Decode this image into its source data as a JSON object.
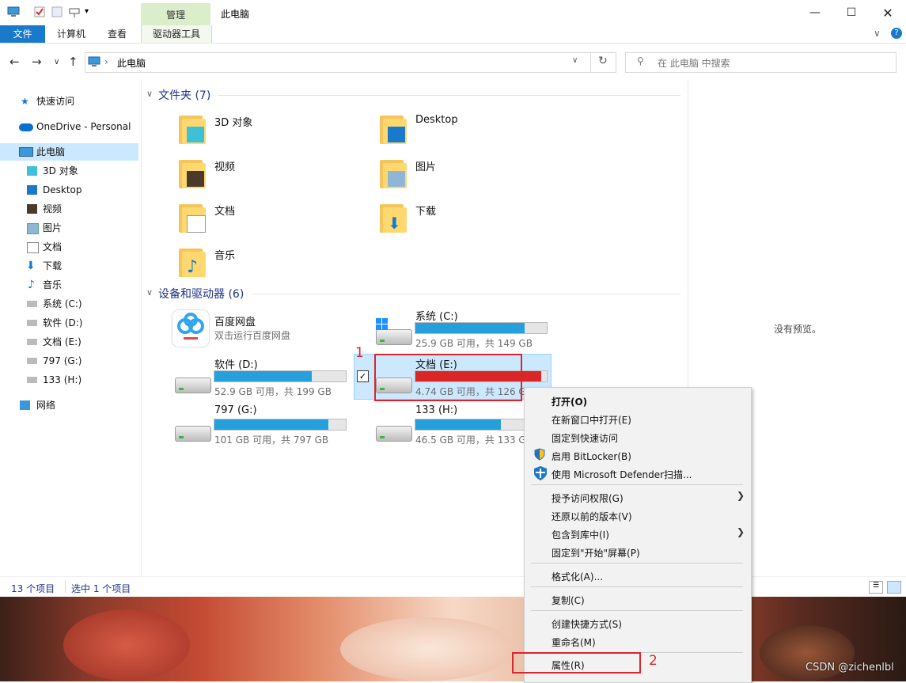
{
  "window": {
    "title": "此电脑",
    "manage_tab": "管理"
  },
  "ribbon": {
    "tabs": [
      "文件",
      "计算机",
      "查看",
      "驱动器工具"
    ]
  },
  "address": {
    "path": "此电脑",
    "search_placeholder": "在 此电脑 中搜索"
  },
  "sidebar": {
    "quick_access": "快速访问",
    "onedrive": "OneDrive - Personal",
    "this_pc": "此电脑",
    "items": [
      "3D 对象",
      "Desktop",
      "视频",
      "图片",
      "文档",
      "下载",
      "音乐",
      "系统 (C:)",
      "软件 (D:)",
      "文档 (E:)",
      "797 (G:)",
      "133 (H:)"
    ],
    "network": "网络"
  },
  "folders_section": {
    "heading": "文件夹 (7)",
    "items": [
      "3D 对象",
      "Desktop",
      "视频",
      "图片",
      "文档",
      "下载",
      "音乐"
    ]
  },
  "devices_section": {
    "heading": "设备和驱动器 (6)",
    "baidu": {
      "name": "百度网盘",
      "sub": "双击运行百度网盘"
    },
    "drives": [
      {
        "name": "系统 (C:)",
        "sub": "25.9 GB 可用，共 149 GB",
        "used_fraction": 0.83
      },
      {
        "name": "软件 (D:)",
        "sub": "52.9 GB 可用，共 199 GB",
        "used_fraction": 0.74
      },
      {
        "name": "文档 (E:)",
        "sub": "4.74 GB 可用，共 126 GB",
        "used_fraction": 0.96
      },
      {
        "name": "797 (G:)",
        "sub": "101 GB 可用，共 797 GB",
        "used_fraction": 0.87
      },
      {
        "name": "133 (H:)",
        "sub": "46.5 GB 可用，共 133 GB",
        "used_fraction": 0.65
      }
    ]
  },
  "preview": {
    "empty_text": "没有预览。"
  },
  "status": {
    "count": "13 个项目",
    "selected": "选中 1 个项目"
  },
  "context_menu": {
    "items": [
      "打开(O)",
      "在新窗口中打开(E)",
      "固定到快速访问",
      "启用 BitLocker(B)",
      "使用 Microsoft Defender扫描...",
      "授予访问权限(G)",
      "还原以前的版本(V)",
      "包含到库中(I)",
      "固定到\"开始\"屏幕(P)",
      "格式化(A)...",
      "复制(C)",
      "创建快捷方式(S)",
      "重命名(M)",
      "属性(R)"
    ]
  },
  "annotations": {
    "one": "1",
    "two": "2"
  },
  "watermark": "CSDN @zichenlbl",
  "colors": {
    "accent": "#1979ca",
    "bar_fill": "#26a0da",
    "bar_full": "#da2626",
    "selection": "#cce8ff",
    "annotation": "#d9262c"
  }
}
